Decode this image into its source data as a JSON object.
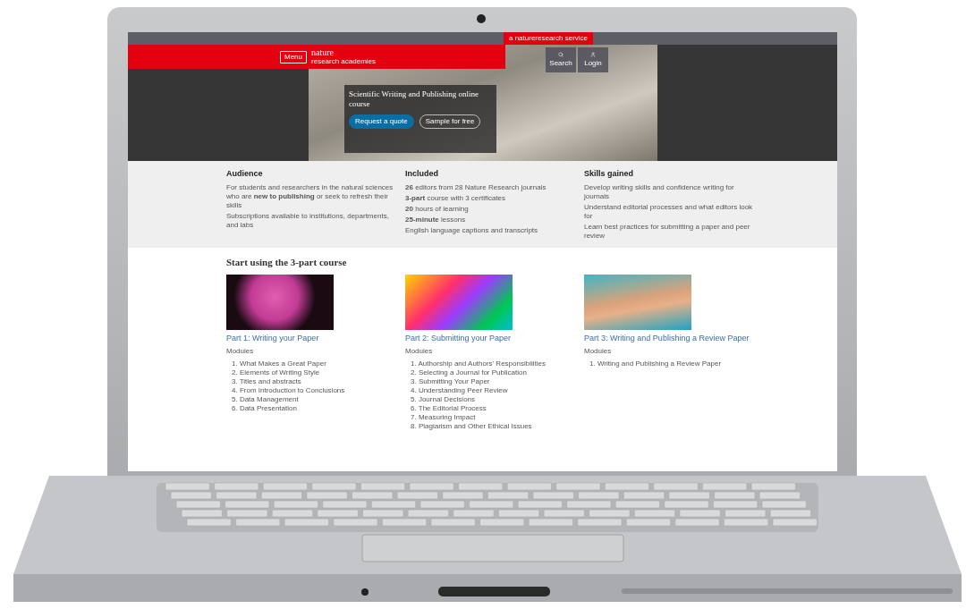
{
  "top_bar": {
    "service_tab": "a natureresearch service"
  },
  "header": {
    "menu_button": "Menu",
    "logo": "nature",
    "logo_sub": "research academies",
    "actions": [
      {
        "label": "Search",
        "kind": "search"
      },
      {
        "label": "Login",
        "kind": "user"
      }
    ]
  },
  "hero": {
    "title": "Scientific Writing and Publishing online course",
    "buttons": [
      {
        "label": "Request a quote",
        "kind": "primary"
      },
      {
        "label": "Sample for free",
        "kind": "outline"
      }
    ]
  },
  "info_columns": [
    {
      "heading": "Audience",
      "paragraphs": [
        "For students and researchers in the natural sciences who are **new to publishing** or seek to refresh their skills",
        "Subscriptions available to institutions, departments, and labs"
      ]
    },
    {
      "heading": "Included",
      "paragraphs": [
        "**26** editors from 28 Nature Research journals",
        "**3-part** course with 3 certificates",
        "**20** hours of learning",
        "**25-minute** lessons",
        "English language captions and transcripts"
      ]
    },
    {
      "heading": "Skills gained",
      "paragraphs": [
        "Develop writing skills and confidence writing for journals",
        "Understand editorial processes and what editors look for",
        "Learn best practices for submitting a paper and peer review"
      ]
    }
  ],
  "courses": {
    "heading": "Start using the 3-part course",
    "parts": [
      {
        "title": "Part 1: Writing your Paper",
        "modules_label": "Modules",
        "modules": [
          "1. What Makes a Great Paper",
          "2. Elements of Writing Style",
          "3. Titles and abstracts",
          "4. From Introduction to Conclusions",
          "5. Data Management",
          "6. Data Presentation"
        ]
      },
      {
        "title": "Part 2: Submitting your Paper",
        "modules_label": "Modules",
        "modules": [
          "1. Authorship and Authors' Responsibilities",
          "2. Selecting a Journal for Publication",
          "3. Submitting Your Paper",
          "4. Understanding Peer Review",
          "5. Journal Decisions",
          "6. The Editorial Process",
          "7. Measuring Impact",
          "8. Plagiarism and Other Ethical Issues"
        ]
      },
      {
        "title": "Part 3: Writing and Publishing a Review Paper",
        "modules_label": "Modules",
        "modules": [
          "1. Writing and Publishing a Review Paper"
        ]
      }
    ]
  }
}
